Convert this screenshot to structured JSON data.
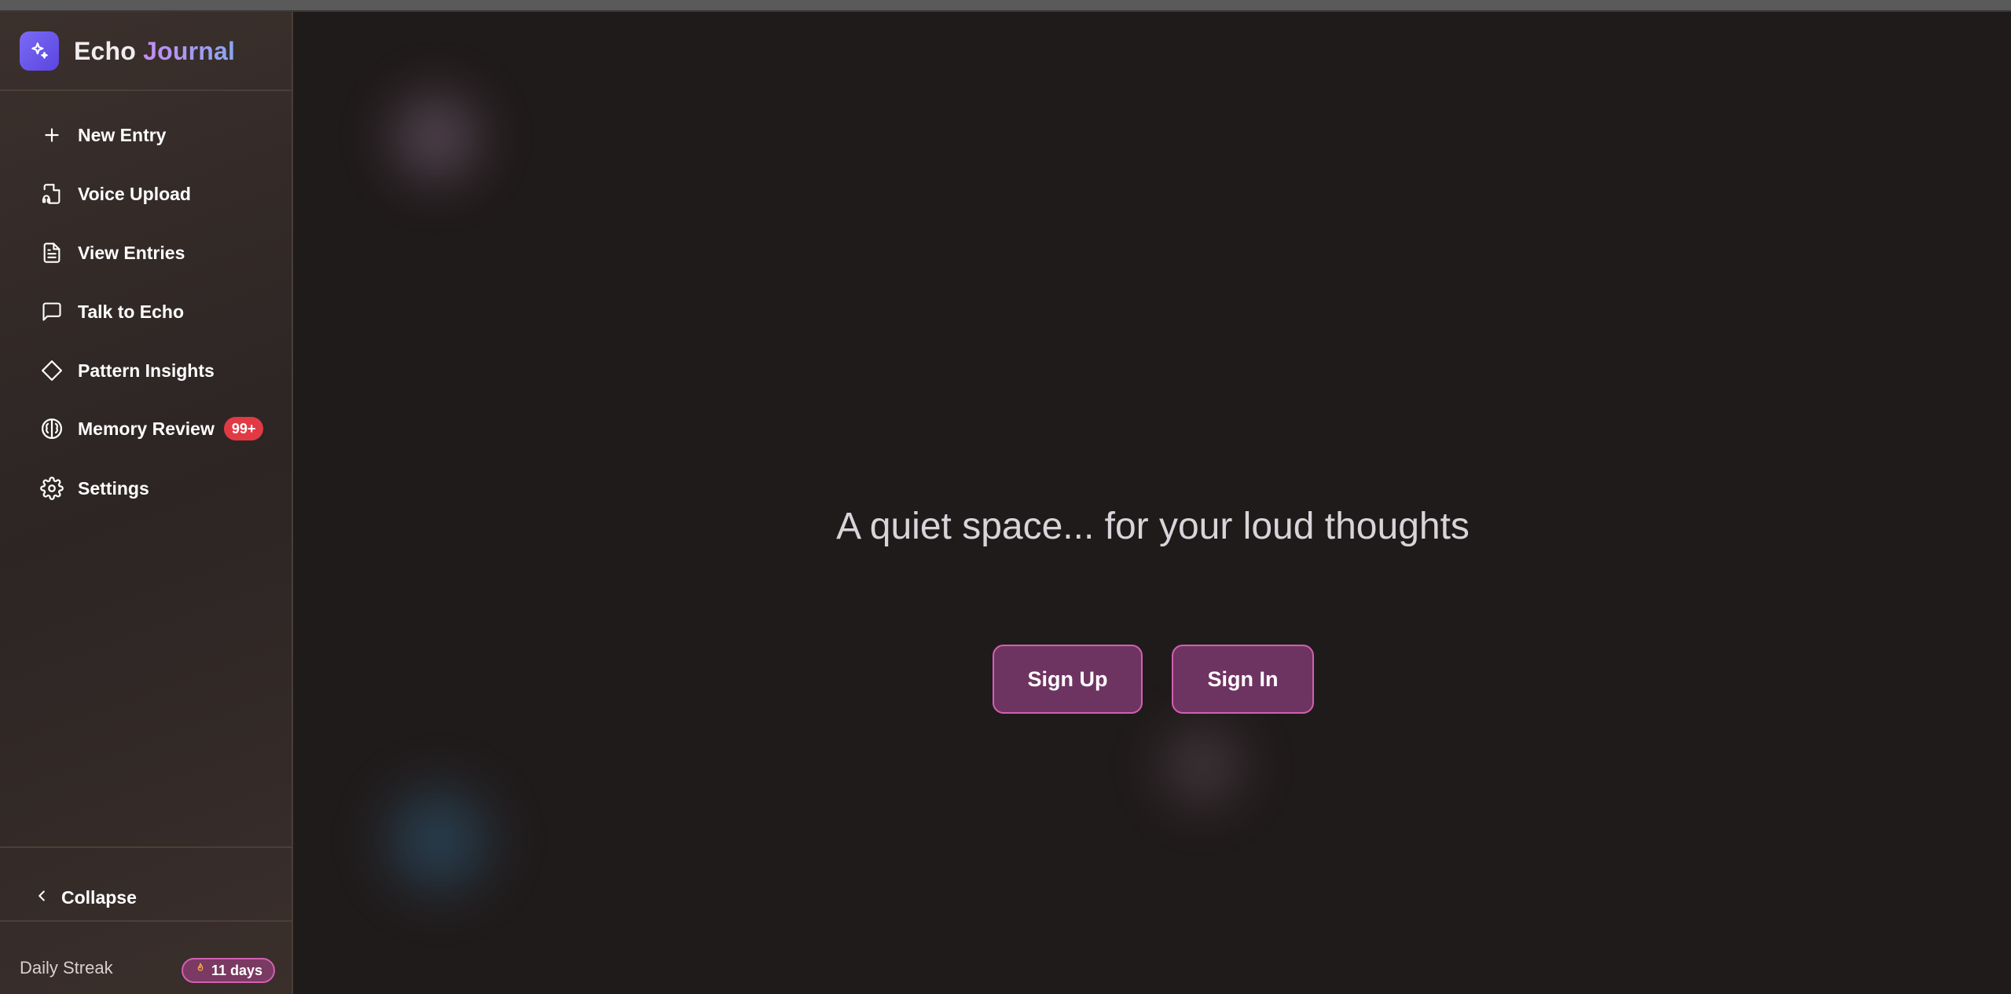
{
  "brand": {
    "name_part1": "Echo",
    "name_part2": "Journal",
    "icon": "sparkles-icon"
  },
  "sidebar": {
    "items": [
      {
        "label": "New Entry",
        "icon": "plus-icon"
      },
      {
        "label": "Voice Upload",
        "icon": "audio-file-icon"
      },
      {
        "label": "View Entries",
        "icon": "document-icon"
      },
      {
        "label": "Talk to Echo",
        "icon": "chat-bubble-icon"
      },
      {
        "label": "Pattern Insights",
        "icon": "diamond-icon"
      },
      {
        "label": "Memory Review",
        "icon": "brain-icon",
        "badge": "99+"
      },
      {
        "label": "Settings",
        "icon": "gear-icon"
      }
    ],
    "collapse_label": "Collapse",
    "streak": {
      "label": "Daily Streak",
      "value": "11 days",
      "icon": "flame-icon"
    }
  },
  "main": {
    "tagline": "A quiet space... for your loud thoughts",
    "signup_label": "Sign Up",
    "signin_label": "Sign In"
  },
  "colors": {
    "background": "#201b1b",
    "sidebar": "#2f2726",
    "accent": "#d35fb2",
    "button": "#6e3461",
    "badge": "#e23a45",
    "brand_icon": "#6a57ea"
  }
}
